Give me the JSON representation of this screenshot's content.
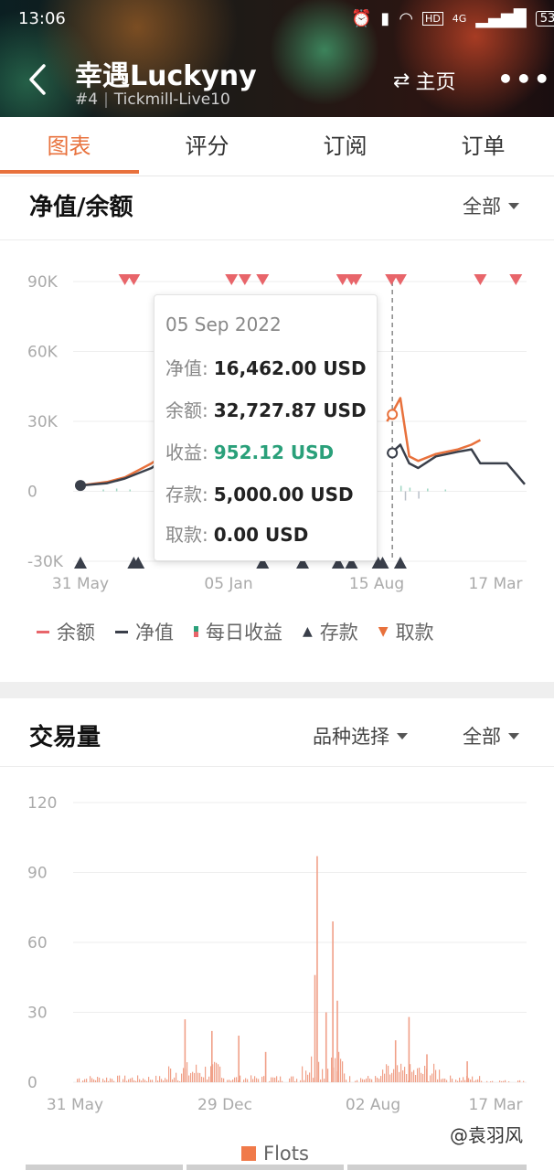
{
  "status_bar": {
    "time": "13:06",
    "network": "4G",
    "battery": "53"
  },
  "header": {
    "title": "幸遇Luckyny",
    "rank": "#4",
    "account": "Tickmill-Live10",
    "home_label": "主页",
    "more_label": "•••"
  },
  "tabs": [
    {
      "label": "图表",
      "active": true
    },
    {
      "label": "评分",
      "active": false
    },
    {
      "label": "订阅",
      "active": false
    },
    {
      "label": "订单",
      "active": false
    }
  ],
  "equity_section": {
    "title": "净值/余额",
    "filter": "全部"
  },
  "tooltip": {
    "date": "05 Sep 2022",
    "equity_label": "净值:",
    "equity_value": "16,462.00 USD",
    "balance_label": "余额:",
    "balance_value": "32,727.87 USD",
    "profit_label": "收益:",
    "profit_value": "952.12 USD",
    "deposit_label": "存款:",
    "deposit_value": "5,000.00 USD",
    "withdraw_label": "取款:",
    "withdraw_value": "0.00 USD"
  },
  "legend": {
    "balance": "余额",
    "equity": "净值",
    "daily_profit": "每日收益",
    "deposit": "存款",
    "withdraw": "取款"
  },
  "volume_section": {
    "title": "交易量",
    "symbol_filter": "品种选择",
    "filter": "全部"
  },
  "flots_legend": "Flots",
  "watermark": "@袁羽风",
  "colors": {
    "accent": "#e8713c",
    "balance": "#e8713c",
    "equity": "#3a3f4a",
    "profit_green": "#2aa07a",
    "withdraw_red": "#e8656a",
    "volume": "#f0a088"
  },
  "chart_data": [
    {
      "type": "line",
      "title": "净值/余额",
      "x_ticks": [
        "31 May",
        "05 Jan",
        "15 Aug",
        "17 Mar"
      ],
      "y_ticks": [
        "90K",
        "60K",
        "30K",
        "0",
        "-30K"
      ],
      "ylim": [
        -30000,
        90000
      ],
      "x": [
        0,
        0.06,
        0.1,
        0.16,
        0.22,
        0.28,
        0.4,
        0.6,
        0.69,
        0.7,
        0.72,
        0.74,
        0.76,
        0.8,
        0.85,
        0.88,
        0.9,
        0.96,
        1.0
      ],
      "series": [
        {
          "name": "余额",
          "values": [
            2500,
            4000,
            6000,
            12000,
            20000,
            22000,
            null,
            null,
            30000,
            33000,
            40000,
            15000,
            13000,
            16000,
            18000,
            20000,
            22000,
            null,
            null
          ]
        },
        {
          "name": "净值",
          "values": [
            2500,
            3500,
            5500,
            10000,
            18000,
            21000,
            null,
            null,
            16000,
            16462,
            20000,
            12000,
            10000,
            15000,
            17000,
            18000,
            12000,
            12000,
            3000
          ]
        }
      ],
      "deposit_markers": [
        0.0,
        0.12,
        0.13,
        0.41,
        0.5,
        0.58,
        0.61,
        0.67,
        0.68,
        0.72
      ],
      "withdraw_markers": [
        0.1,
        0.12,
        0.34,
        0.37,
        0.41,
        0.59,
        0.61,
        0.62,
        0.7,
        0.72,
        0.9,
        0.98
      ],
      "legend": [
        "余额",
        "净值",
        "每日收益",
        "存款",
        "取款"
      ],
      "legend_position": "bottom"
    },
    {
      "type": "bar",
      "title": "交易量",
      "x_ticks": [
        "31 May",
        "29 Dec",
        "02 Aug",
        "17 Mar"
      ],
      "y_ticks": [
        "120",
        "90",
        "60",
        "30",
        "0"
      ],
      "ylim": [
        0,
        120
      ],
      "series": [
        {
          "name": "Flots"
        }
      ],
      "spikes": [
        {
          "x": 0.24,
          "v": 27
        },
        {
          "x": 0.3,
          "v": 22
        },
        {
          "x": 0.36,
          "v": 20
        },
        {
          "x": 0.42,
          "v": 13
        },
        {
          "x": 0.53,
          "v": 46
        },
        {
          "x": 0.535,
          "v": 97
        },
        {
          "x": 0.555,
          "v": 30
        },
        {
          "x": 0.57,
          "v": 69
        },
        {
          "x": 0.58,
          "v": 35
        },
        {
          "x": 0.71,
          "v": 18
        },
        {
          "x": 0.74,
          "v": 28
        },
        {
          "x": 0.78,
          "v": 12
        },
        {
          "x": 0.87,
          "v": 9
        }
      ],
      "legend_position": "bottom"
    }
  ]
}
